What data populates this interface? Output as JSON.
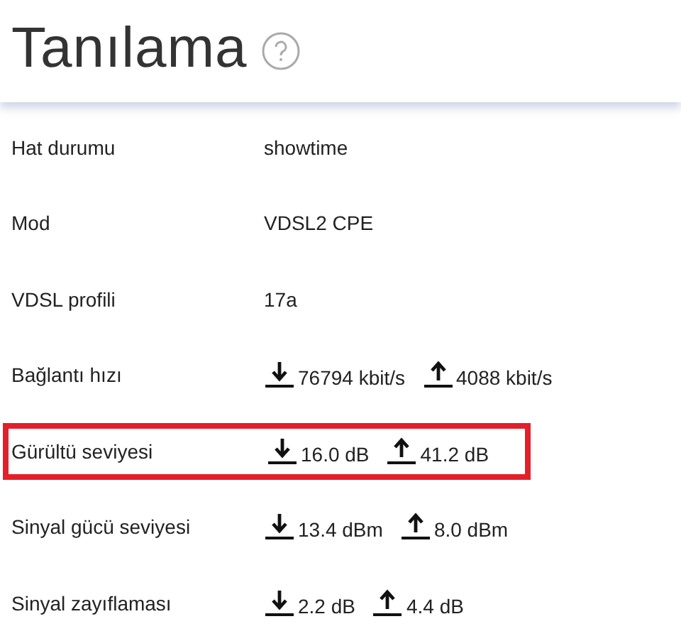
{
  "title": "Tanılama",
  "rows": [
    {
      "label": "Hat durumu",
      "kind": "text",
      "value": "showtime",
      "highlighted": false
    },
    {
      "label": "Mod",
      "kind": "text",
      "value": "VDSL2 CPE",
      "highlighted": false
    },
    {
      "label": "VDSL profili",
      "kind": "text",
      "value": "17a",
      "highlighted": false
    },
    {
      "label": "Bağlantı hızı",
      "kind": "updown",
      "down": "76794 kbit/s",
      "up": "4088 kbit/s",
      "highlighted": false
    },
    {
      "label": "Gürültü seviyesi",
      "kind": "updown",
      "down": "16.0 dB",
      "up": "41.2 dB",
      "highlighted": true
    },
    {
      "label": "Sinyal gücü seviyesi",
      "kind": "updown",
      "down": "13.4 dBm",
      "up": "8.0 dBm",
      "highlighted": false
    },
    {
      "label": "Sinyal zayıflaması",
      "kind": "updown",
      "down": "2.2 dB",
      "up": "4.4 dB",
      "highlighted": false
    }
  ]
}
